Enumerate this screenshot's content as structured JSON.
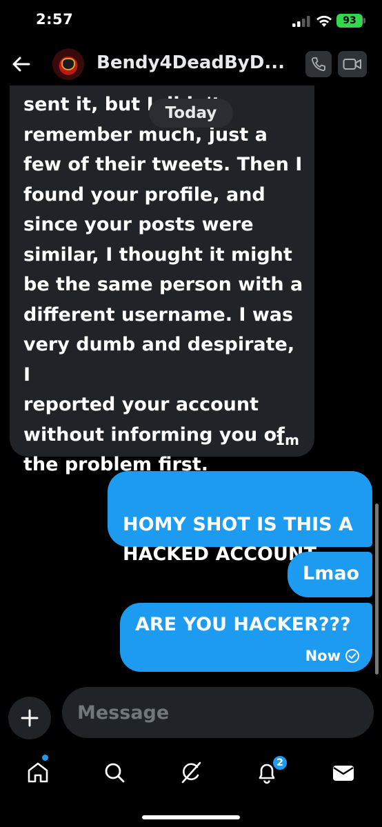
{
  "status_bar": {
    "time": "2:57",
    "battery": "93"
  },
  "header": {
    "contact_name": "Bendy4DeadByD...",
    "back_icon": "arrow-left-icon",
    "call_icon": "phone-icon",
    "video_icon": "video-camera-icon"
  },
  "conversation": {
    "date_separator": "Today",
    "received": [
      {
        "text": "sent it, but I didn't\nremember much, just a\nfew of their tweets. Then I\nfound your profile, and\nsince your posts were\nsimilar, I thought it might\nbe the same person with a\ndifferent username. I was\nvery dumb and despirate, I\nreported your account\nwithout informing you of\nthe problem first.",
        "time": "1m"
      }
    ],
    "sent": [
      {
        "text": "HOMY SHOT IS THIS A\nHACKED ACCOUNT"
      },
      {
        "text": "Lmao"
      },
      {
        "text": "ARE YOU HACKER???",
        "time": "Now",
        "status_icon": "check-circle-icon"
      }
    ]
  },
  "composer": {
    "placeholder": "Message",
    "add_icon": "plus-icon"
  },
  "bottom_nav": {
    "items": [
      {
        "name": "home",
        "icon": "home-icon",
        "has_dot": true
      },
      {
        "name": "search",
        "icon": "search-icon"
      },
      {
        "name": "grok",
        "icon": "grok-icon"
      },
      {
        "name": "notifications",
        "icon": "bell-icon",
        "badge": "2"
      },
      {
        "name": "messages",
        "icon": "envelope-icon"
      }
    ]
  },
  "colors": {
    "accent": "#1d9bf0",
    "received_bubble": "#202327",
    "background": "#000000"
  }
}
